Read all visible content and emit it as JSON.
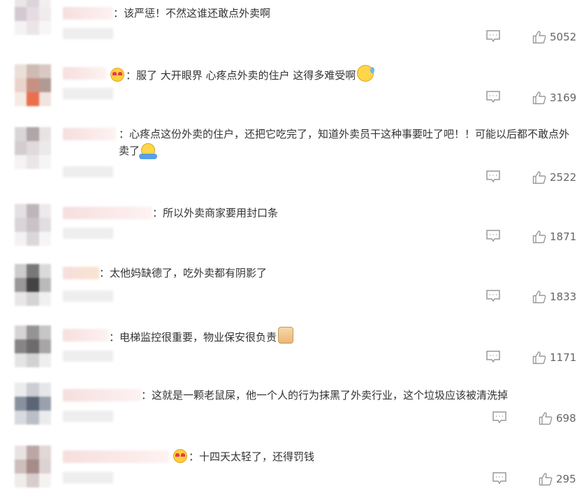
{
  "colors": {
    "text": "#333333",
    "muted": "#666666",
    "icon": "#999999",
    "name_blur": "#f6dede"
  },
  "comments": [
    {
      "text": "：该严惩！不然这谁还敢点外卖啊",
      "likes": "5052",
      "reply_icon": "comment-icon",
      "like_icon": "thumb-up-icon"
    },
    {
      "text": "：服了 大开眼界 心疼点外卖的住户 这得多难受啊",
      "likes": "3169",
      "reply_icon": "comment-icon",
      "like_icon": "thumb-up-icon",
      "lead_emoji": "love-eyes-emoji",
      "trail_emoji": "sweat-emoji"
    },
    {
      "text": "：心疼点这份外卖的住户，还把它吃完了，知道外卖员干这种事要吐了吧！！可能以后都不敢点外卖了",
      "likes": "2522",
      "reply_icon": "comment-icon",
      "like_icon": "thumb-up-icon",
      "trail_emoji": "shrug-emoji"
    },
    {
      "text": "：所以外卖商家要用封口条",
      "likes": "1871",
      "reply_icon": "comment-icon",
      "like_icon": "thumb-up-icon"
    },
    {
      "text": "：太他妈缺德了，吃外卖都有阴影了",
      "likes": "1833",
      "reply_icon": "comment-icon",
      "like_icon": "thumb-up-icon"
    },
    {
      "text": "：电梯监控很重要，物业保安很负责",
      "likes": "1171",
      "reply_icon": "comment-icon",
      "like_icon": "thumb-up-icon",
      "trail_emoji": "thumbs-up-emoji"
    },
    {
      "text": "：这就是一颗老鼠屎，他一个人的行为抹黑了外卖行业，这个垃圾应该被清洗掉",
      "likes": "698",
      "reply_icon": "comment-icon",
      "like_icon": "thumb-up-icon"
    },
    {
      "text": "：十四天太轻了，还得罚钱",
      "likes": "295",
      "reply_icon": "comment-icon",
      "like_icon": "thumb-up-icon",
      "lead_emoji": "love-eyes-emoji"
    }
  ]
}
